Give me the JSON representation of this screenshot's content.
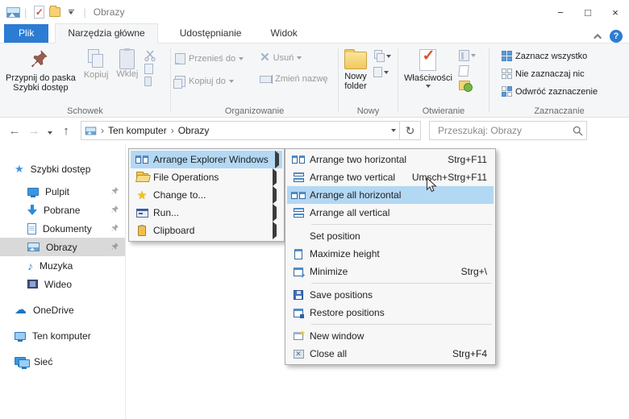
{
  "window": {
    "title": "Obrazy",
    "controls": {
      "minimize": "−",
      "maximize": "□",
      "close": "×"
    },
    "help": "?"
  },
  "tabs": {
    "file": "Plik",
    "home": "Narzędzia główne",
    "share": "Udostępnianie",
    "view": "Widok"
  },
  "ribbon": {
    "clipboard_group": {
      "pin_line1": "Przypnij do paska",
      "pin_line2": "Szybki dostęp",
      "copy": "Kopiuj",
      "paste": "Wklej",
      "label": "Schowek"
    },
    "organize_group": {
      "move_to": "Przenieś do",
      "copy_to": "Kopiuj do",
      "delete": "Usuń",
      "rename": "Zmień nazwę",
      "label": "Organizowanie"
    },
    "new_group": {
      "new_folder_line1": "Nowy",
      "new_folder_line2": "folder",
      "label": "Nowy"
    },
    "open_group": {
      "properties": "Właściwości",
      "label": "Otwieranie"
    },
    "select_group": {
      "select_all": "Zaznacz wszystko",
      "select_none": "Nie zaznaczaj nic",
      "invert": "Odwróć zaznaczenie",
      "label": "Zaznaczanie"
    }
  },
  "addressbar": {
    "crumb_root": "Ten komputer",
    "crumb_current": "Obrazy",
    "search_placeholder": "Przeszukaj: Obrazy"
  },
  "sidebar": {
    "quick_access": "Szybki dostęp",
    "items": [
      {
        "label": "Pulpit",
        "pinned": true
      },
      {
        "label": "Pobrane",
        "pinned": true
      },
      {
        "label": "Dokumenty",
        "pinned": true
      },
      {
        "label": "Obrazy",
        "pinned": true,
        "selected": true
      },
      {
        "label": "Muzyka",
        "pinned": false
      },
      {
        "label": "Wideo",
        "pinned": false
      }
    ],
    "roots": [
      {
        "label": "OneDrive"
      },
      {
        "label": "Ten komputer"
      },
      {
        "label": "Sieć"
      }
    ]
  },
  "menus": {
    "main": {
      "items": [
        {
          "label": "Arrange Explorer Windows",
          "highlighted": true
        },
        {
          "label": "File Operations"
        },
        {
          "label": "Change to..."
        },
        {
          "label": "Run..."
        },
        {
          "label": "Clipboard"
        }
      ]
    },
    "submenu": {
      "items": [
        {
          "label": "Arrange two horizontal",
          "shortcut": "Strg+F11"
        },
        {
          "label": "Arrange two vertical",
          "shortcut": "Umsch+Strg+F11"
        },
        {
          "label": "Arrange all horizontal",
          "shortcut": "",
          "highlighted": true
        },
        {
          "label": "Arrange all vertical",
          "shortcut": ""
        },
        {
          "label": "Set position",
          "shortcut": ""
        },
        {
          "label": "Maximize height",
          "shortcut": ""
        },
        {
          "label": "Minimize",
          "shortcut": "Strg+\\"
        },
        {
          "label": "Save positions",
          "shortcut": ""
        },
        {
          "label": "Restore positions",
          "shortcut": ""
        },
        {
          "label": "New window",
          "shortcut": ""
        },
        {
          "label": "Close all",
          "shortcut": "Strg+F4"
        }
      ]
    }
  },
  "icons": {
    "search": "magnifier",
    "refresh": "↻",
    "back": "←",
    "forward": "→",
    "up": "↑"
  },
  "colors": {
    "accent_blue": "#2b7cd3",
    "menu_highlight": "#b3d8f4",
    "selected_gray": "#d9d9d9",
    "ribbon_bg": "#f5f6f7"
  }
}
